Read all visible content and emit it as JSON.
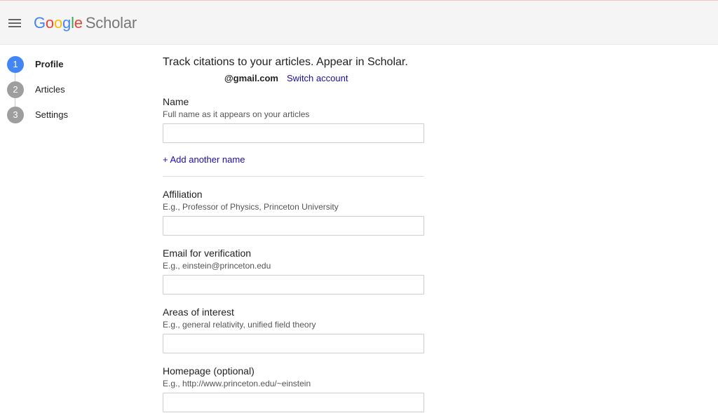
{
  "header": {
    "menu_icon": "hamburger-menu-icon",
    "logo_letters": [
      "G",
      "o",
      "o",
      "g",
      "l",
      "e"
    ],
    "logo_product": "Scholar"
  },
  "steps": [
    {
      "number": "1",
      "label": "Profile",
      "active": true
    },
    {
      "number": "2",
      "label": "Articles",
      "active": false
    },
    {
      "number": "3",
      "label": "Settings",
      "active": false
    }
  ],
  "form": {
    "headline": "Track citations to your articles. Appear in Scholar.",
    "account_email": "@gmail.com",
    "switch_account_label": "Switch account",
    "name": {
      "label": "Name",
      "hint": "Full name as it appears on your articles",
      "value": ""
    },
    "add_name_label": "+ Add another name",
    "affiliation": {
      "label": "Affiliation",
      "hint": "E.g., Professor of Physics, Princeton University",
      "value": ""
    },
    "email_verification": {
      "label": "Email for verification",
      "hint": "E.g., einstein@princeton.edu",
      "value": ""
    },
    "areas_of_interest": {
      "label": "Areas of interest",
      "hint": "E.g., general relativity, unified field theory",
      "value": ""
    },
    "homepage": {
      "label": "Homepage (optional)",
      "hint": "E.g., http://www.princeton.edu/~einstein",
      "value": ""
    }
  },
  "colors": {
    "google_blue": "#4285f4",
    "google_red": "#ea4335",
    "google_yellow": "#fbbc05",
    "google_green": "#34a853",
    "link": "#1a0dab",
    "step_inactive": "#9e9e9e"
  }
}
